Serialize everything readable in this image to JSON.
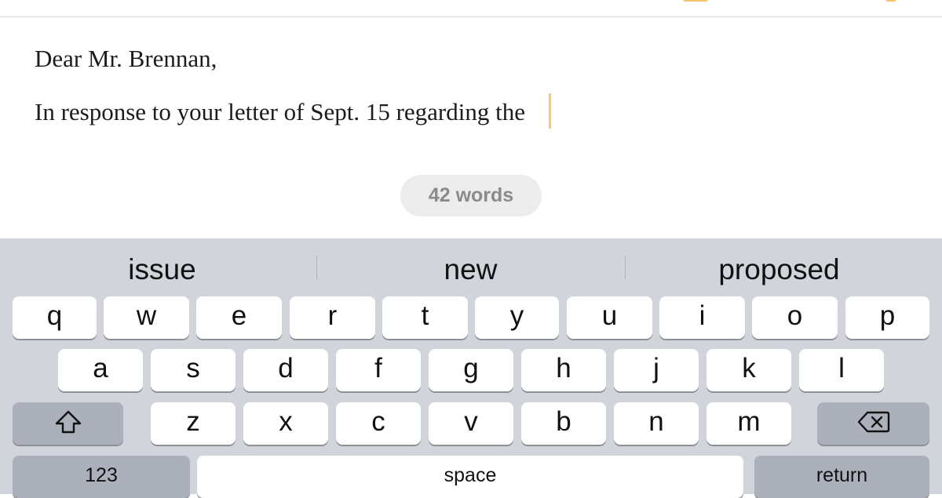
{
  "document": {
    "greeting": "Dear Mr. Brennan,",
    "body_text": "In response to your letter of Sept. 15 regarding the"
  },
  "word_count_label": "42 words",
  "colors": {
    "caret": "#f1c77a",
    "toolbar_accent": "#f4c26b",
    "keyboard_bg": "#d1d4da",
    "key_bg": "#ffffff",
    "function_key_bg": "#abb0bb"
  },
  "keyboard": {
    "suggestions": [
      "issue",
      "new",
      "proposed"
    ],
    "row1": [
      "q",
      "w",
      "e",
      "r",
      "t",
      "y",
      "u",
      "i",
      "o",
      "p"
    ],
    "row2": [
      "a",
      "s",
      "d",
      "f",
      "g",
      "h",
      "j",
      "k",
      "l"
    ],
    "row3": [
      "z",
      "x",
      "c",
      "v",
      "b",
      "n",
      "m"
    ],
    "shift_icon": "shift-arrow-icon",
    "delete_icon": "backspace-icon",
    "numbers_label": "123",
    "space_label": "space",
    "return_label": "return"
  }
}
